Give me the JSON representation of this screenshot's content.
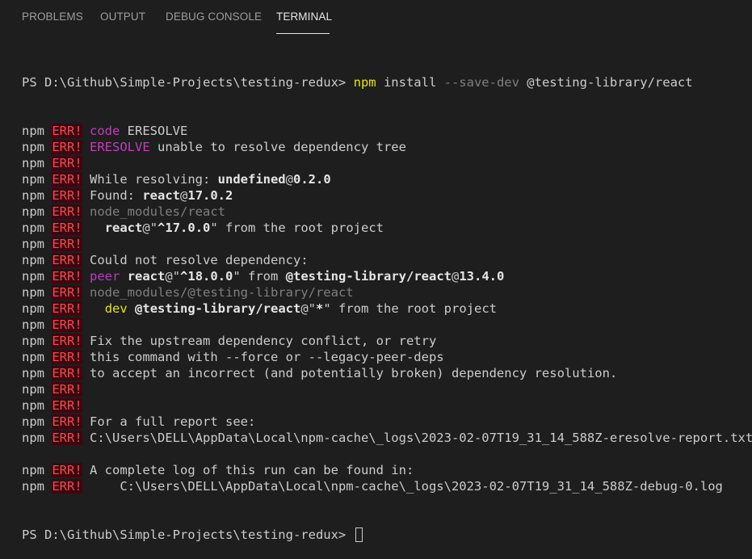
{
  "tabs": [
    "PROBLEMS",
    "OUTPUT",
    "DEBUG CONSOLE",
    "TERMINAL"
  ],
  "active_tab": "TERMINAL",
  "prompt": "PS D:\\Github\\Simple-Projects\\testing-redux>",
  "command": {
    "npm": "npm",
    "rest": " install ",
    "flag": "--save-dev",
    "pkg": " @testing-library/react"
  },
  "npm_prefix": "npm",
  "err_tag": "ERR!",
  "lines": [
    {
      "npm": true,
      "segs": [
        {
          "c": "m",
          "t": "code"
        },
        {
          "c": "w",
          "t": " ERESOLVE"
        }
      ]
    },
    {
      "npm": true,
      "segs": [
        {
          "c": "m",
          "t": "ERESOLVE"
        },
        {
          "c": "w",
          "t": " unable to resolve dependency tree"
        }
      ]
    },
    {
      "npm": true,
      "segs": []
    },
    {
      "npm": true,
      "segs": [
        {
          "c": "w",
          "t": "While resolving: "
        },
        {
          "c": "b",
          "t": "undefined"
        },
        {
          "c": "w",
          "t": "@"
        },
        {
          "c": "b",
          "t": "0.2.0"
        }
      ]
    },
    {
      "npm": true,
      "segs": [
        {
          "c": "w",
          "t": "Found: "
        },
        {
          "c": "b",
          "t": "react"
        },
        {
          "c": "w",
          "t": "@"
        },
        {
          "c": "b",
          "t": "17.0.2"
        }
      ]
    },
    {
      "npm": true,
      "segs": [
        {
          "c": "g",
          "t": "node_modules/react"
        }
      ]
    },
    {
      "npm": true,
      "segs": [
        {
          "c": "w",
          "t": "  "
        },
        {
          "c": "b",
          "t": "react"
        },
        {
          "c": "w",
          "t": "@\""
        },
        {
          "c": "b",
          "t": "^17.0.0"
        },
        {
          "c": "w",
          "t": "\" from the root project"
        }
      ]
    },
    {
      "npm": true,
      "segs": []
    },
    {
      "npm": true,
      "segs": [
        {
          "c": "w",
          "t": "Could not resolve dependency:"
        }
      ]
    },
    {
      "npm": true,
      "segs": [
        {
          "c": "m",
          "t": "peer"
        },
        {
          "c": "w",
          "t": " "
        },
        {
          "c": "b",
          "t": "react"
        },
        {
          "c": "w",
          "t": "@\""
        },
        {
          "c": "b",
          "t": "^18.0.0"
        },
        {
          "c": "w",
          "t": "\" from "
        },
        {
          "c": "b",
          "t": "@testing-library/react"
        },
        {
          "c": "w",
          "t": "@"
        },
        {
          "c": "b",
          "t": "13.4.0"
        }
      ]
    },
    {
      "npm": true,
      "segs": [
        {
          "c": "g",
          "t": "node_modules/@testing-library/react"
        }
      ]
    },
    {
      "npm": true,
      "segs": [
        {
          "c": "w",
          "t": "  "
        },
        {
          "c": "y",
          "t": "dev"
        },
        {
          "c": "w",
          "t": " "
        },
        {
          "c": "b",
          "t": "@testing-library/react"
        },
        {
          "c": "w",
          "t": "@\""
        },
        {
          "c": "b",
          "t": "*"
        },
        {
          "c": "w",
          "t": "\" from the root project"
        }
      ]
    },
    {
      "npm": true,
      "segs": []
    },
    {
      "npm": true,
      "segs": [
        {
          "c": "w",
          "t": "Fix the upstream dependency conflict, or retry"
        }
      ]
    },
    {
      "npm": true,
      "segs": [
        {
          "c": "w",
          "t": "this command with --force or --legacy-peer-deps"
        }
      ]
    },
    {
      "npm": true,
      "segs": [
        {
          "c": "w",
          "t": "to accept an incorrect (and potentially broken) dependency resolution."
        }
      ]
    },
    {
      "npm": true,
      "segs": []
    },
    {
      "npm": true,
      "segs": []
    },
    {
      "npm": true,
      "segs": [
        {
          "c": "w",
          "t": "For a full report see:"
        }
      ]
    },
    {
      "npm": true,
      "segs": [
        {
          "c": "w",
          "t": "C:\\Users\\DELL\\AppData\\Local\\npm-cache\\_logs\\2023-02-07T19_31_14_588Z-eresolve-report.txt"
        }
      ]
    },
    {
      "npm": false,
      "segs": []
    },
    {
      "npm": true,
      "segs": [
        {
          "c": "w",
          "t": "A complete log of this run can be found in:"
        }
      ]
    },
    {
      "npm": true,
      "segs": [
        {
          "c": "w",
          "t": "    C:\\Users\\DELL\\AppData\\Local\\npm-cache\\_logs\\2023-02-07T19_31_14_588Z-debug-0.log"
        }
      ]
    }
  ]
}
